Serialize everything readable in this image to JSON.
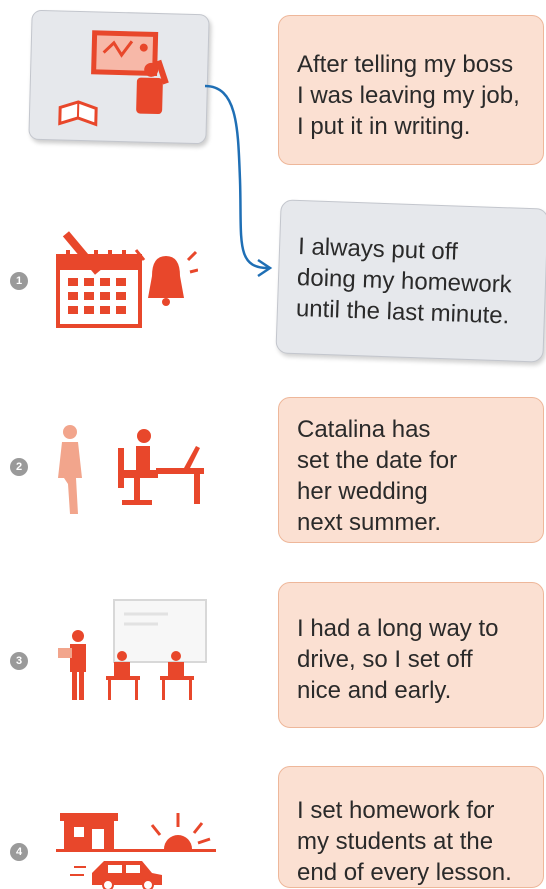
{
  "cards": [
    {
      "lines": [
        "After telling my boss",
        "I was leaving my job,",
        "I put it in writing."
      ]
    },
    {
      "lines": [
        "I always put off",
        "doing my homework",
        "until the last minute."
      ]
    },
    {
      "lines": [
        "Catalina has",
        "set the date for",
        "her wedding",
        "next summer."
      ]
    },
    {
      "lines": [
        "I had a long way to",
        "drive, so I set off",
        "nice and early."
      ]
    },
    {
      "lines": [
        "I set homework for",
        "my students at the",
        "end of every lesson."
      ]
    }
  ],
  "numbers": [
    "1",
    "2",
    "3",
    "4"
  ],
  "colors": {
    "accent": "#e8472b",
    "arrow": "#1f6fb5",
    "peach": "#fbe0d2",
    "grey_card": "#e6e8ec"
  },
  "icons": [
    "teacher-board-icon",
    "calendar-alarm-icon",
    "woman-and-desk-icon",
    "classroom-icon",
    "house-sunrise-car-icon"
  ]
}
